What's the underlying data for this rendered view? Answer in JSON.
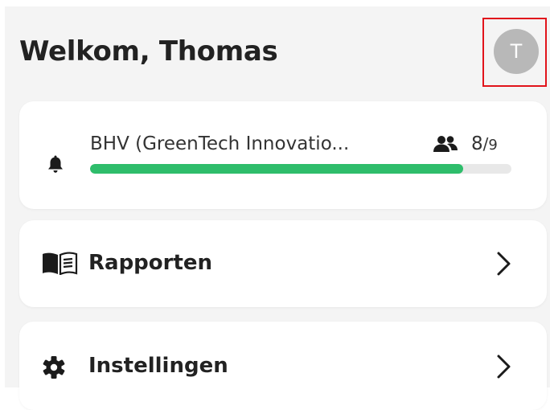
{
  "header": {
    "greeting": "Welkom, Thomas",
    "avatar_initial": "T"
  },
  "bhv_card": {
    "label": "BHV (GreenTech Innovatio...",
    "count_current": "8",
    "count_separator": "/",
    "count_total": "9",
    "progress": 0.885,
    "icons": [
      "bell-icon",
      "people-icon"
    ],
    "progress_color": "#2ebd6b"
  },
  "menu": {
    "rapporten": {
      "label": "Rapporten",
      "icon": "book-icon"
    },
    "instellingen": {
      "label": "Instellingen",
      "icon": "gear-icon"
    }
  },
  "colors": {
    "highlight_border": "#e1141b",
    "avatar_bg": "#b8b8b8"
  }
}
